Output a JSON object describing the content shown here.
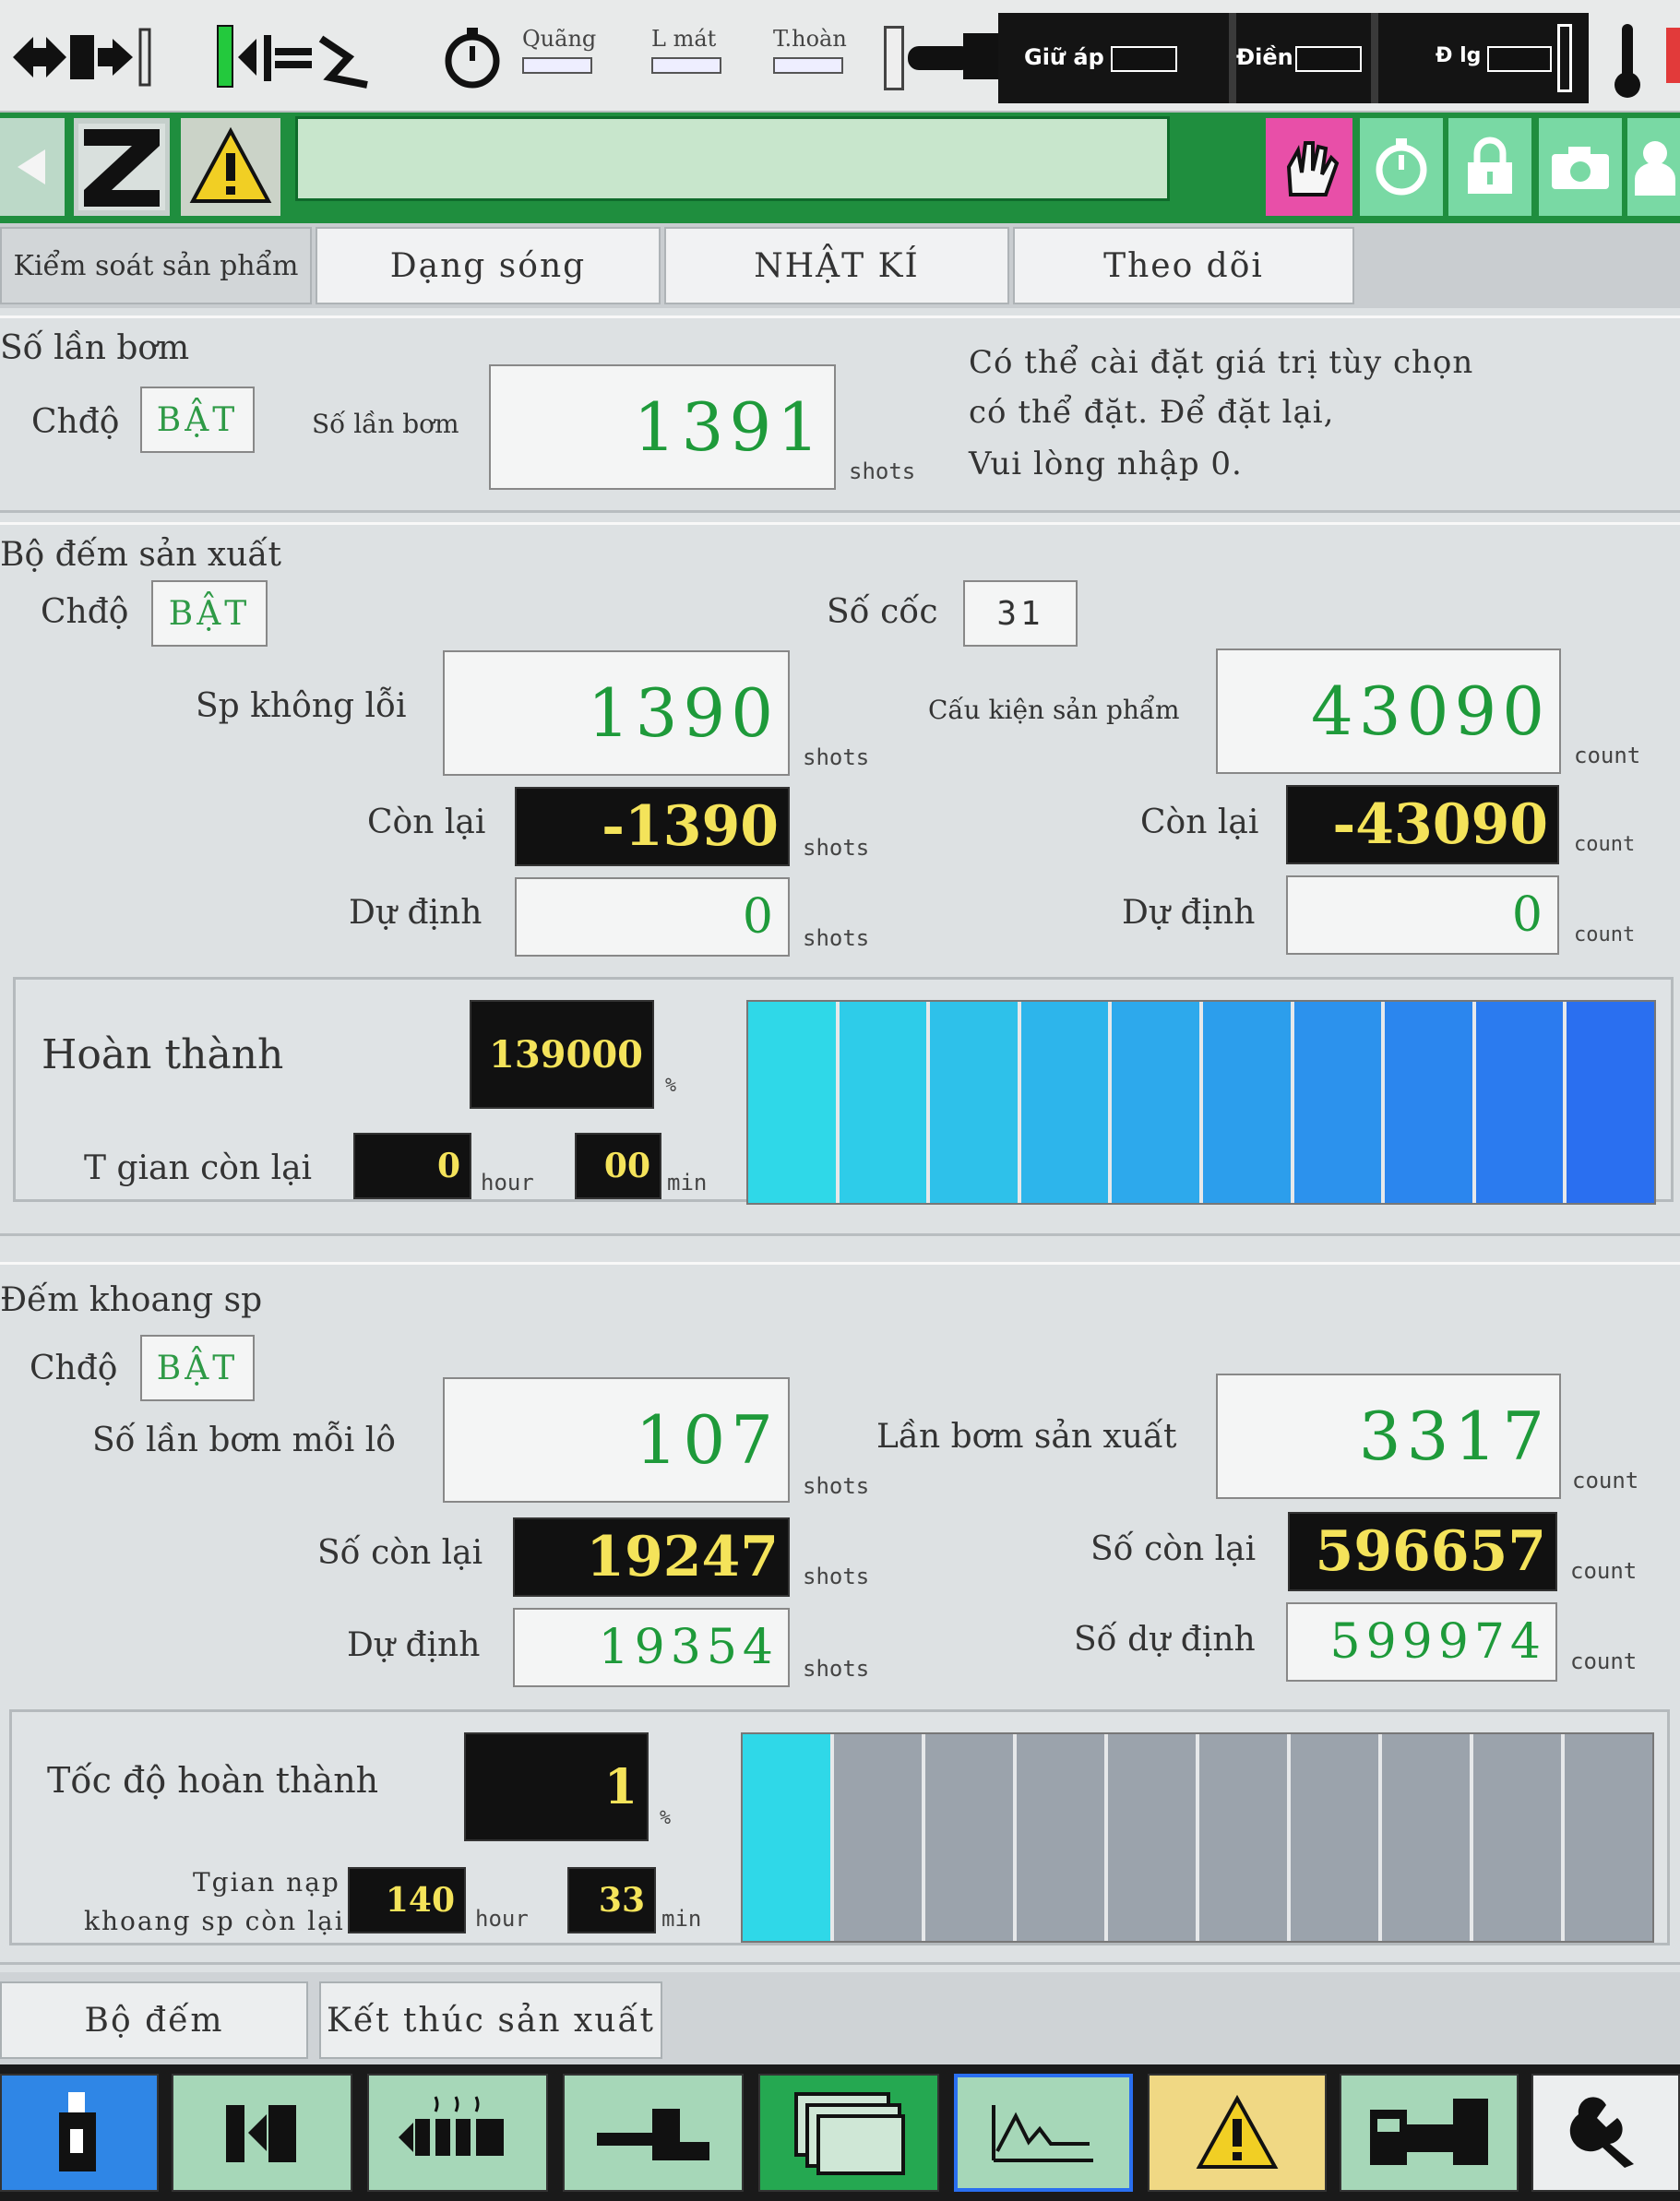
{
  "status_bar": {
    "labels": [
      "Quãng",
      "L mát",
      "T.hoàn"
    ],
    "dark_labels": [
      "Giữ áp",
      "Điền",
      "Đ lg"
    ]
  },
  "toolbar": {
    "icons": [
      "z-logo-icon",
      "warning-icon",
      "hand-touch-icon",
      "stopwatch-icon",
      "lock-icon",
      "camera-icon",
      "user-icon"
    ],
    "message": ""
  },
  "tabs": [
    {
      "label": "Kiểm soát sản phẩm",
      "active": true
    },
    {
      "label": "Dạng sóng",
      "active": false
    },
    {
      "label": "NHẬT KÍ",
      "active": false
    },
    {
      "label": "Theo dõi",
      "active": false
    }
  ],
  "shot_count": {
    "title": "Số lần bơm",
    "mode_label": "Chđộ",
    "mode_value": "BẬT",
    "counter_label": "Số lần bơm",
    "counter_value": "1391",
    "counter_unit": "shots",
    "note_lines": [
      "Có thể cài đặt giá trị tùy chọn",
      "có thể đặt. Để đặt lại,",
      "Vui lòng nhập 0."
    ]
  },
  "production_counter": {
    "title": "Bộ đếm sản xuất",
    "mode_label": "Chđộ",
    "mode_value": "BẬT",
    "cavity_label": "Số cốc",
    "cavity_value": "31",
    "good_label": "Sp không lỗi",
    "good_value": "1390",
    "good_unit": "shots",
    "parts_label": "Cấu kiện sản phẩm",
    "parts_value": "43090",
    "parts_unit": "count",
    "remaining_label": "Còn lại",
    "remaining_shots": "-1390",
    "remaining_shots_unit": "shots",
    "remaining_count_label": "Còn lại",
    "remaining_count": "-43090",
    "remaining_count_unit": "count",
    "planned_label": "Dự định",
    "planned_shots": "0",
    "planned_shots_unit": "shots",
    "planned_count_label": "Dự định",
    "planned_count": "0",
    "planned_count_unit": "count",
    "complete_label": "Hoàn thành",
    "complete_value": "139000",
    "complete_unit": "%",
    "time_left_label": "T gian còn lại",
    "time_hours": "0",
    "hour_unit": "hour",
    "time_minutes": "00",
    "min_unit": "min",
    "progress_fraction": 1.0
  },
  "interval_counter": {
    "title": "Đếm khoang sp",
    "mode_label": "Chđộ",
    "mode_value": "BẬT",
    "per_lot_label": "Số lần bơm mỗi lô",
    "per_lot_value": "107",
    "per_lot_unit": "shots",
    "production_shots_label": "Lần bơm sản xuất",
    "production_shots_value": "3317",
    "production_shots_unit": "count",
    "remaining_label": "Số còn lại",
    "remaining_value": "19247",
    "remaining_unit": "shots",
    "remaining_count_label": "Số còn lại",
    "remaining_count_value": "596657",
    "remaining_count_unit": "count",
    "planned_label": "Dự định",
    "planned_value": "19354",
    "planned_unit": "shots",
    "planned_count_label": "Số dự định",
    "planned_count_value": "599974",
    "planned_count_unit": "count",
    "rate_label": "Tốc độ hoàn thành",
    "rate_value": "1",
    "rate_unit": "%",
    "feed_label_1": "Tgian nạp",
    "feed_label_2": "khoang sp còn lại",
    "feed_hours": "140",
    "hour_unit": "hour",
    "feed_minutes": "33",
    "min_unit": "min",
    "progress_fraction": 0.01
  },
  "bottom_buttons": [
    "Bộ đếm",
    "Kết thúc sản xuất"
  ],
  "nav_icons": [
    "injection-unit-icon",
    "mold-clamp-icon",
    "heater-icon",
    "ejector-icon",
    "screens-icon",
    "waveform-icon",
    "alarm-icon",
    "machine-icon",
    "wrench-icon"
  ],
  "colors": {
    "accent_green": "#1f8e3e",
    "value_green": "#1e9a3a",
    "value_yellow": "#f4e35a",
    "bar_cyan": "#2fd8e8",
    "bar_blue": "#2a6ff0"
  }
}
